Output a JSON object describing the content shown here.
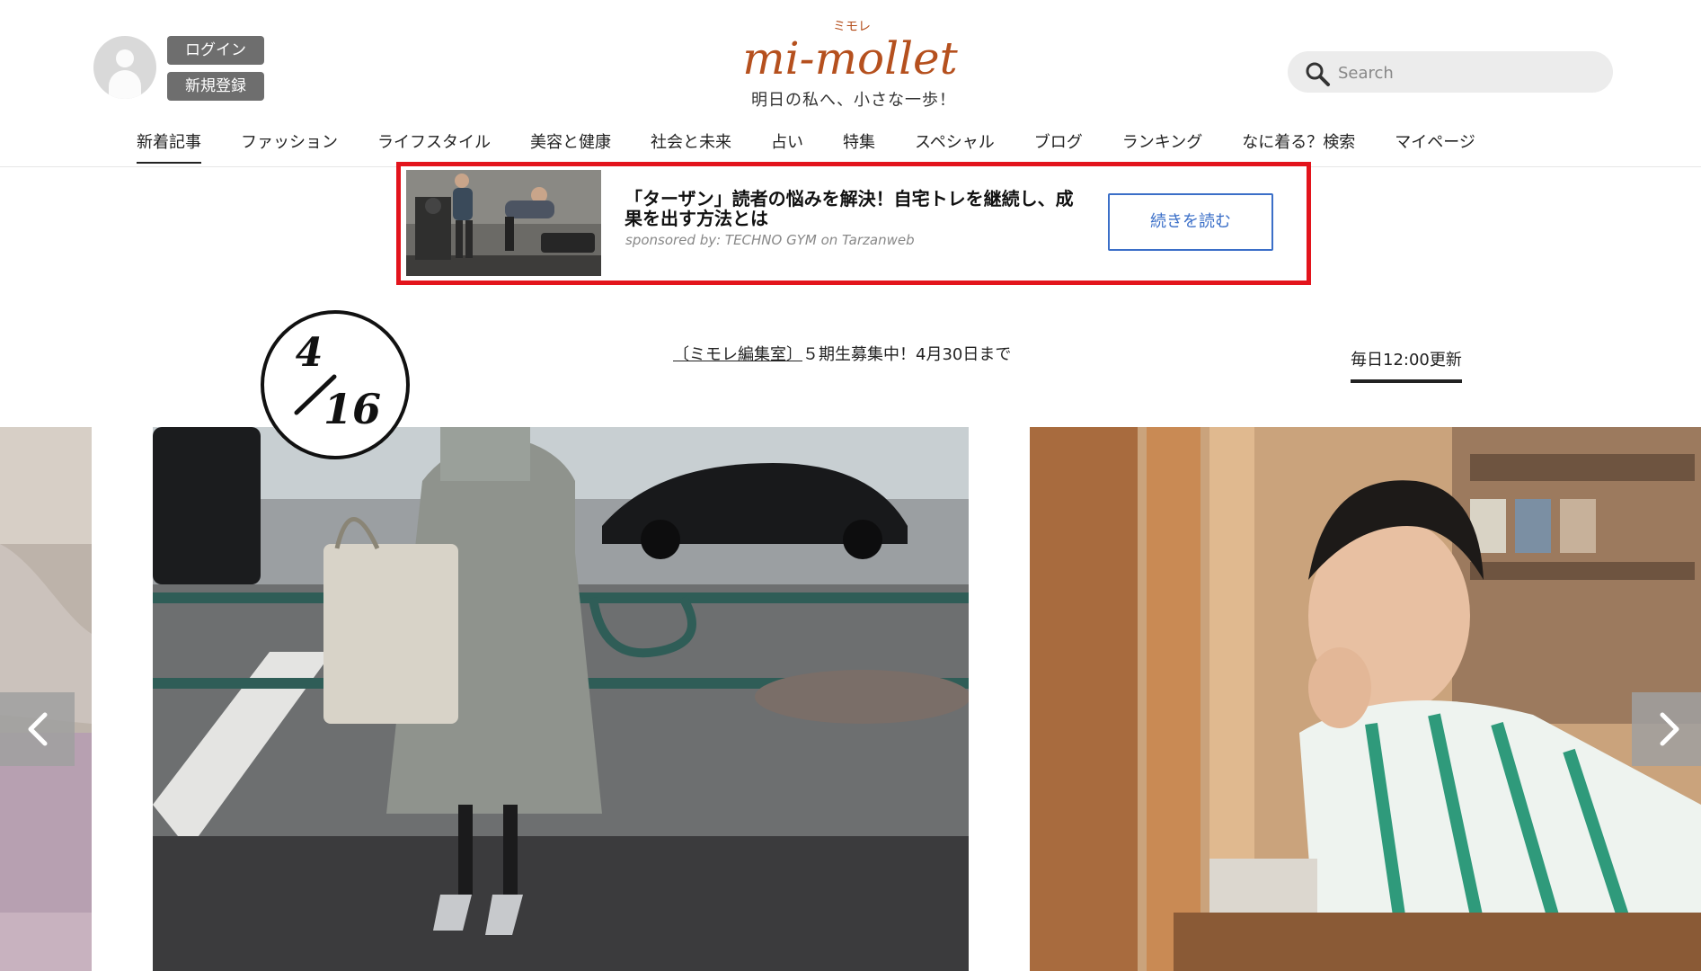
{
  "header": {
    "login_label": "ログイン",
    "signup_label": "新規登録",
    "logo_text": "mi-mollet",
    "logo_kana": "ミモレ",
    "tagline": "明日の私へ、小さな一歩！",
    "search_placeholder": "Search"
  },
  "nav": {
    "items": [
      {
        "label": "新着記事",
        "active": true
      },
      {
        "label": "ファッション"
      },
      {
        "label": "ライフスタイル"
      },
      {
        "label": "美容と健康"
      },
      {
        "label": "社会と未来"
      },
      {
        "label": "占い"
      },
      {
        "label": "特集"
      },
      {
        "label": "スペシャル"
      },
      {
        "label": "ブログ"
      },
      {
        "label": "ランキング"
      },
      {
        "label": "なに着る？検索"
      },
      {
        "label": "マイページ"
      }
    ]
  },
  "ad": {
    "title": "「ターザン」読者の悩みを解決！自宅トレを継続し、成果を出す方法とは",
    "sponsor": "sponsored by: TECHNO GYM on Tarzanweb",
    "cta_label": "続きを読む"
  },
  "date_badge": {
    "month": "4",
    "day": "16"
  },
  "notice": {
    "link_text": "〔ミモレ編集室〕",
    "text": "５期生募集中！4月30日まで"
  },
  "daily_update": "毎日12:00更新",
  "colors": {
    "ad_border": "#e3141c",
    "cta_blue": "#3b6fc8",
    "logo_brown": "#b5501e",
    "auth_button_gray": "#6e6e6e"
  }
}
